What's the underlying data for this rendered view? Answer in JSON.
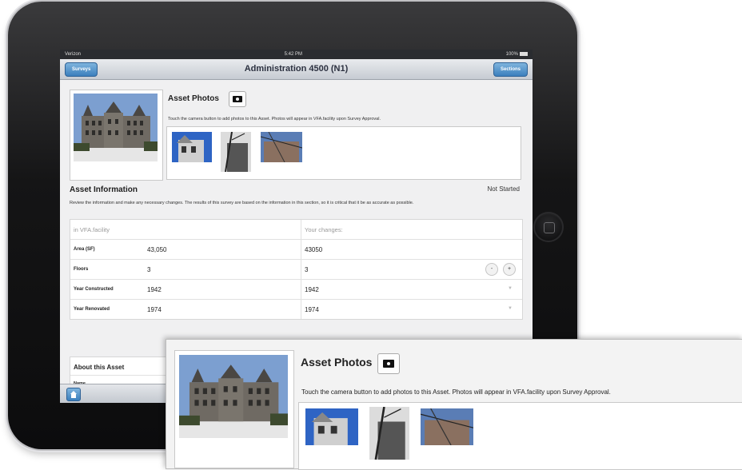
{
  "status_bar": {
    "carrier": "Verizon",
    "time": "5:42 PM",
    "battery": "100%"
  },
  "nav": {
    "title": "Administration 4500 (N1)",
    "left_button": "Surveys",
    "right_button": "Sections"
  },
  "asset_photos": {
    "title": "Asset Photos",
    "help": "Touch the camera button to add photos to this Asset. Photos will appear in VFA.facility upon Survey Approval."
  },
  "asset_info": {
    "title": "Asset Information",
    "status": "Not Started",
    "description": "Review the information and make any necessary changes. The results of this survey are based on the information in this section, so it is critical that it be as accurate as possible.",
    "header_current": "in VFA.facility",
    "header_changes": "Your changes:",
    "rows": [
      {
        "label": "Area (SF)",
        "current": "43,050",
        "changes": "43050"
      },
      {
        "label": "Floors",
        "current": "3",
        "changes": "3"
      },
      {
        "label": "Year Constructed",
        "current": "1942",
        "changes": "1942"
      },
      {
        "label": "Year Renovated",
        "current": "1974",
        "changes": "1974"
      }
    ],
    "stepper_minus": "-",
    "stepper_plus": "+"
  },
  "about": {
    "title": "About this Asset",
    "name_label": "Name"
  },
  "icons": {
    "camera": "camera-icon",
    "home": "home-icon",
    "dropdown": "chevron-down-icon"
  }
}
